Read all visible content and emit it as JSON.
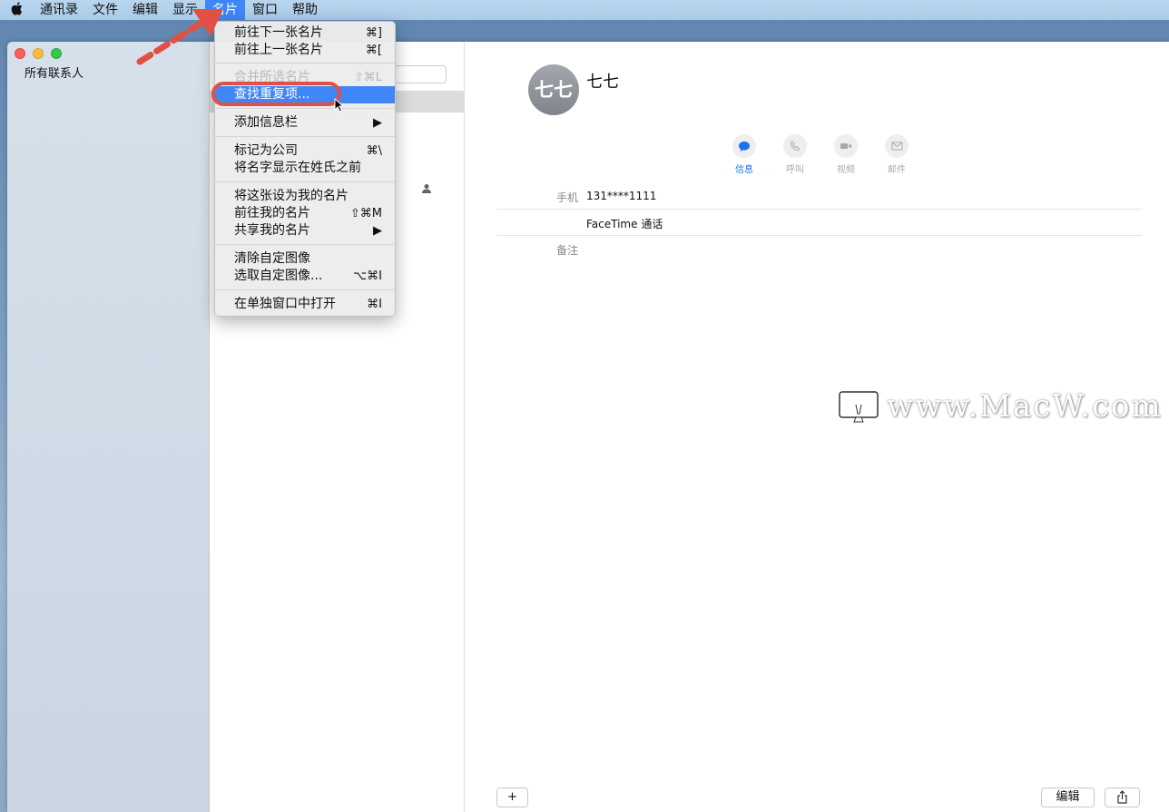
{
  "menubar": {
    "items": [
      "通讯录",
      "文件",
      "编辑",
      "显示",
      "名片",
      "窗口",
      "帮助"
    ],
    "active": "名片"
  },
  "sidebar": {
    "group_label": "所有联系人"
  },
  "menu": {
    "next_card": "前往下一张名片",
    "next_card_sc": "⌘]",
    "prev_card": "前往上一张名片",
    "prev_card_sc": "⌘[",
    "merge": "合并所选名片",
    "merge_sc": "⇧⌘L",
    "find_duplicates": "查找重复项...",
    "add_field": "添加信息栏",
    "add_field_sc": "▶",
    "mark_company": "标记为公司",
    "mark_company_sc": "⌘\\",
    "name_order": "将名字显示在姓氏之前",
    "set_my_card": "将这张设为我的名片",
    "go_my_card": "前往我的名片",
    "go_my_card_sc": "⇧⌘M",
    "share_my_card": "共享我的名片",
    "share_my_card_sc": "▶",
    "clear_image": "清除自定图像",
    "choose_image": "选取自定图像...",
    "choose_image_sc": "⌥⌘I",
    "open_window": "在单独窗口中打开",
    "open_window_sc": "⌘I"
  },
  "contact": {
    "initials": "七七",
    "name": "七七",
    "actions": [
      "信息",
      "呼叫",
      "视频",
      "邮件"
    ],
    "phone_label": "手机",
    "phone_value": "131****1111",
    "facetime": "FaceTime 通话",
    "note_label": "备注"
  },
  "bottom": {
    "add": "+",
    "edit": "编辑"
  },
  "watermark": {
    "text": "www.MacW.com"
  },
  "colors": {
    "highlight": "#3f86f7",
    "annotation": "#e25045",
    "accent": "#1a73e8"
  }
}
